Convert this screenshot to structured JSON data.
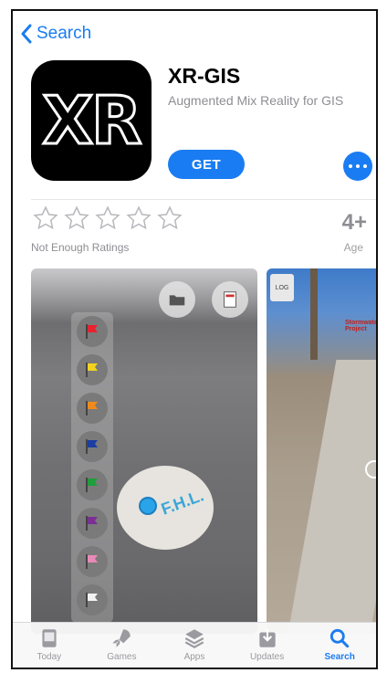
{
  "nav": {
    "back_label": "Search"
  },
  "app": {
    "icon_text": "XR",
    "name": "XR-GIS",
    "subtitle": "Augmented Mix Reality for GIS",
    "get_label": "GET"
  },
  "ratings": {
    "stars_filled": 0,
    "stars_total": 5,
    "label": "Not Enough Ratings",
    "age_value": "4+",
    "age_label": "Age"
  },
  "screenshots": {
    "flags": [
      "#e8222e",
      "#f3d21f",
      "#f18a1e",
      "#1b3ea0",
      "#1f9e3c",
      "#7b2e94",
      "#e88ab8",
      "#f2f2f2"
    ],
    "painted_text": "F.H.L.",
    "shot2_log": "LOG",
    "shot2_sign": "Stormwater Project"
  },
  "tabbar": {
    "items": [
      {
        "label": "Today",
        "icon": "today-icon",
        "active": false
      },
      {
        "label": "Games",
        "icon": "rocket-icon",
        "active": false
      },
      {
        "label": "Apps",
        "icon": "layers-icon",
        "active": false
      },
      {
        "label": "Updates",
        "icon": "download-icon",
        "active": false
      },
      {
        "label": "Search",
        "icon": "search-icon",
        "active": true
      }
    ]
  },
  "colors": {
    "accent": "#1a7cf2",
    "secondary_text": "#8e8e93"
  }
}
